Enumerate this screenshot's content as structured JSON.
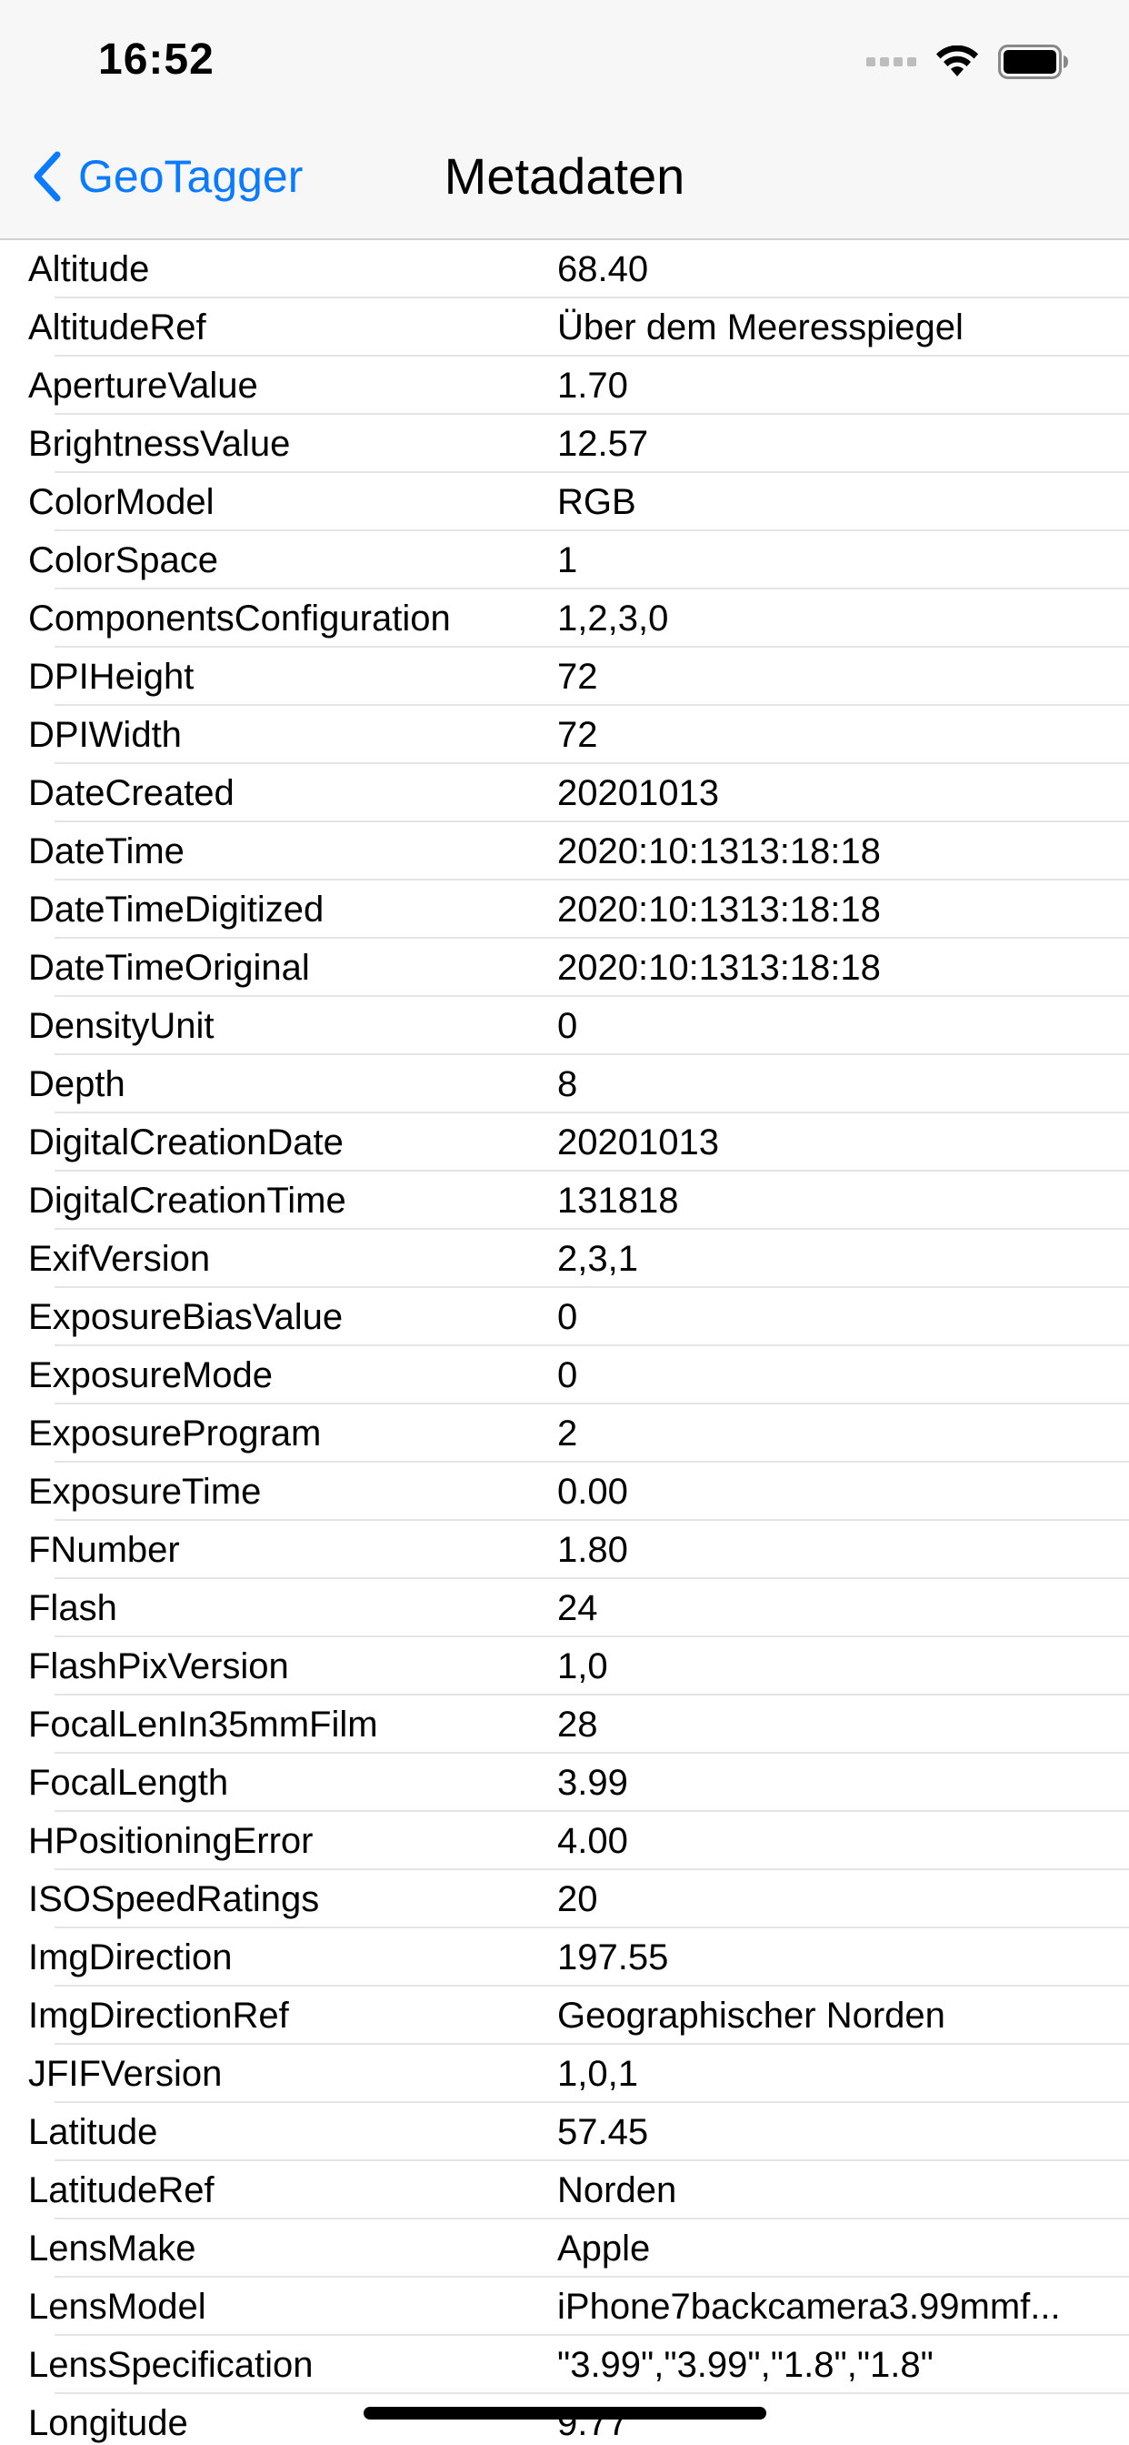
{
  "status_bar": {
    "time": "16:52"
  },
  "nav": {
    "back_label": "GeoTagger",
    "title": "Metadaten"
  },
  "colors": {
    "accent": "#0a7aff",
    "nav_background": "#f7f7f7",
    "separator": "#e4e4e8"
  },
  "icons": {
    "back": "chevron-left-icon",
    "signal": "cellular-signal-icon",
    "wifi": "wifi-icon",
    "battery": "battery-icon"
  },
  "rows": [
    {
      "key": "Altitude",
      "value": "68.40"
    },
    {
      "key": "AltitudeRef",
      "value": "Über dem Meeresspiegel"
    },
    {
      "key": "ApertureValue",
      "value": "1.70"
    },
    {
      "key": "BrightnessValue",
      "value": "12.57"
    },
    {
      "key": "ColorModel",
      "value": "RGB"
    },
    {
      "key": "ColorSpace",
      "value": "1"
    },
    {
      "key": "ComponentsConfiguration",
      "value": "1,2,3,0"
    },
    {
      "key": "DPIHeight",
      "value": "72"
    },
    {
      "key": "DPIWidth",
      "value": "72"
    },
    {
      "key": "DateCreated",
      "value": "20201013"
    },
    {
      "key": "DateTime",
      "value": "2020:10:1313:18:18"
    },
    {
      "key": "DateTimeDigitized",
      "value": "2020:10:1313:18:18"
    },
    {
      "key": "DateTimeOriginal",
      "value": "2020:10:1313:18:18"
    },
    {
      "key": "DensityUnit",
      "value": "0"
    },
    {
      "key": "Depth",
      "value": "8"
    },
    {
      "key": "DigitalCreationDate",
      "value": "20201013"
    },
    {
      "key": "DigitalCreationTime",
      "value": "131818"
    },
    {
      "key": "ExifVersion",
      "value": "2,3,1"
    },
    {
      "key": "ExposureBiasValue",
      "value": "0"
    },
    {
      "key": "ExposureMode",
      "value": "0"
    },
    {
      "key": "ExposureProgram",
      "value": "2"
    },
    {
      "key": "ExposureTime",
      "value": "0.00"
    },
    {
      "key": "FNumber",
      "value": "1.80"
    },
    {
      "key": "Flash",
      "value": "24"
    },
    {
      "key": "FlashPixVersion",
      "value": "1,0"
    },
    {
      "key": "FocalLenIn35mmFilm",
      "value": "28"
    },
    {
      "key": "FocalLength",
      "value": "3.99"
    },
    {
      "key": "HPositioningError",
      "value": "4.00"
    },
    {
      "key": "ISOSpeedRatings",
      "value": "20"
    },
    {
      "key": "ImgDirection",
      "value": "197.55"
    },
    {
      "key": "ImgDirectionRef",
      "value": "Geographischer Norden"
    },
    {
      "key": "JFIFVersion",
      "value": "1,0,1"
    },
    {
      "key": "Latitude",
      "value": "57.45"
    },
    {
      "key": "LatitudeRef",
      "value": "Norden"
    },
    {
      "key": "LensMake",
      "value": "Apple"
    },
    {
      "key": "LensModel",
      "value": "iPhone7backcamera3.99mmf..."
    },
    {
      "key": "LensSpecification",
      "value": "\"3.99\",\"3.99\",\"1.8\",\"1.8\""
    },
    {
      "key": "Longitude",
      "value": "9.77"
    }
  ]
}
